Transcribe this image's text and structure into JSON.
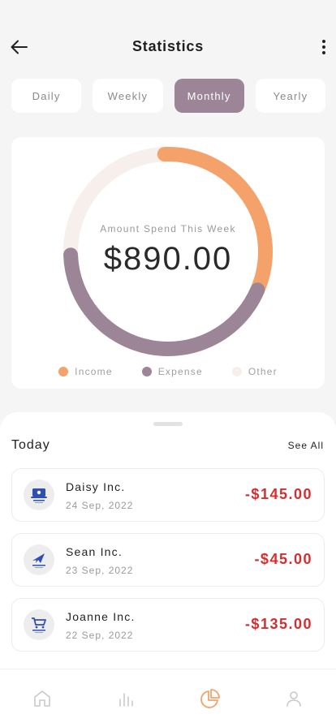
{
  "header": {
    "title": "Statistics"
  },
  "tabs": [
    {
      "label": "Daily",
      "active": false
    },
    {
      "label": "Weekly",
      "active": false
    },
    {
      "label": "Monthly",
      "active": true
    },
    {
      "label": "Yearly",
      "active": false
    }
  ],
  "chart": {
    "label": "Amount Spend This Week",
    "amount": "$890.00",
    "colors": {
      "income": "#f5a26a",
      "expense": "#9b8597",
      "other": "#f7efec"
    },
    "legend": [
      {
        "label": "Income",
        "color": "#f5a26a"
      },
      {
        "label": "Expense",
        "color": "#9b8597"
      },
      {
        "label": "Other",
        "color": "#f7efec"
      }
    ]
  },
  "chart_data": {
    "type": "pie",
    "style": "donut",
    "categories": [
      "Income",
      "Expense",
      "Other"
    ],
    "values": [
      0.32,
      0.43,
      0.25
    ]
  },
  "section": {
    "title": "Today",
    "see_all": "See All"
  },
  "transactions": [
    {
      "name": "Daisy Inc.",
      "date": "24 Sep, 2022",
      "amount": "-$145.00",
      "icon": "laptop-shop-logo-icon"
    },
    {
      "name": "Sean Inc.",
      "date": "23 Sep, 2022",
      "amount": "-$45.00",
      "icon": "delivery-plane-logo-icon"
    },
    {
      "name": "Joanne Inc.",
      "date": "22 Sep, 2022",
      "amount": "-$135.00",
      "icon": "shopping-cart-logo-icon"
    }
  ],
  "nav": [
    {
      "icon": "home-icon",
      "active": false
    },
    {
      "icon": "bar-chart-icon",
      "active": false
    },
    {
      "icon": "pie-chart-icon",
      "active": true
    },
    {
      "icon": "profile-icon",
      "active": false
    }
  ],
  "colors": {
    "accent": "#9b8597",
    "active_nav": "#f5a26a",
    "negative": "#d32f2f"
  }
}
